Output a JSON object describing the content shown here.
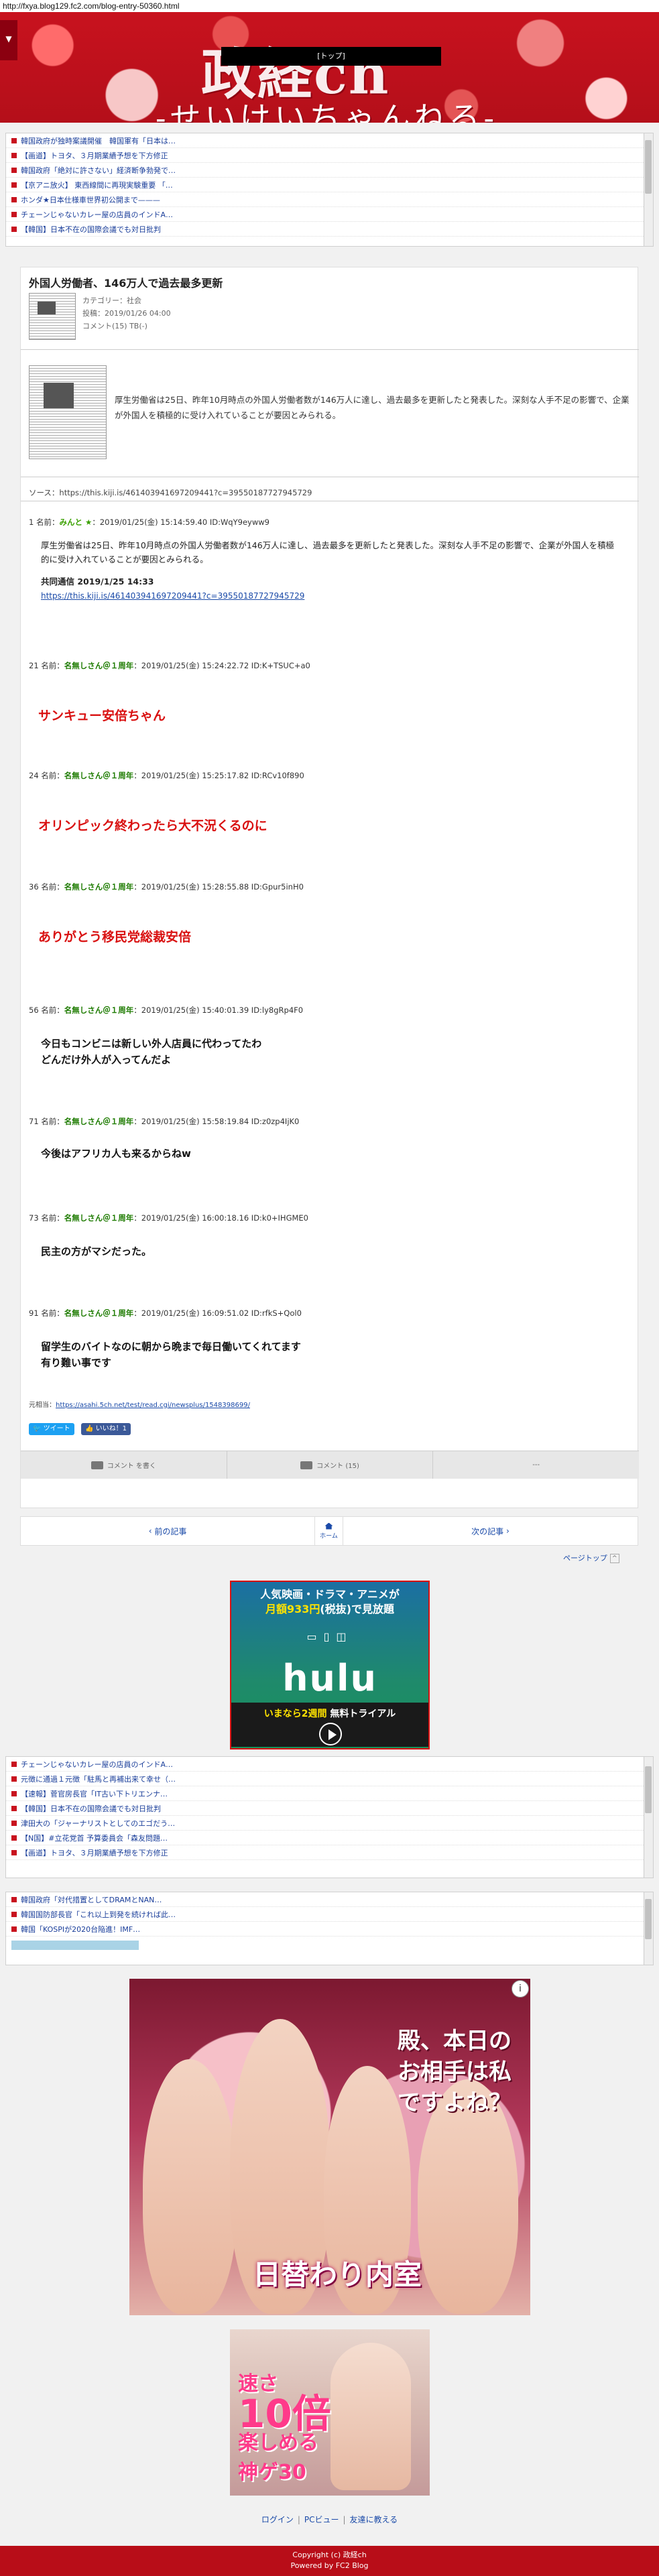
{
  "browser": {
    "url": "http://fxya.blog129.fc2.com/blog-entry-50360.html"
  },
  "header": {
    "menu_icon": "caret-down-icon",
    "nav_label": "[トップ]",
    "title": "政経ch",
    "subtitle": "-せいけいちゃんねる-"
  },
  "top_feed": [
    "韓国政府が独時案議開催　韓国軍有「日本は…",
    "【画道】トヨタ、３月期業績予想を下方修正",
    "韓国政府「絶対に許さない」経済断争勃発で…",
    "【京アニ放火】 東西線間に再現実験重要 「…",
    "ホンダ★日本仕様車世界初公開まで———",
    "チェーンじゃないカレー屋の店員のインドA…",
    "【韓国】日本不在の国際会議でも対日批判"
  ],
  "article": {
    "title": "外国人労働者、146万人で過去最多更新",
    "category": "カテゴリー：社会",
    "posted": "投稿：2019/01/26 04:00",
    "comments": "コメント(15)  TB(-)",
    "lead": "厚生労働省は25日、昨年10月時点の外国人労働者数が146万人に達し、過去最多を更新したと発表した。深刻な人手不足の影響で、企業が外国人を積極的に受け入れていることが要因とみられる。",
    "source": "ソース：https://this.kiji.is/461403941697209441?c=39550187727945729",
    "res1_head_prefix": "1 名前：",
    "res1_name": "みんと ★",
    "res1_meta": "：2019/01/25(金) 15:14:59.40 ID:WqY9eyww9",
    "res1_body": "厚生労働省は25日、昨年10月時点の外国人労働者数が146万人に達し、過去最多を更新したと発表した。深刻な人手不足の影響で、企業が外国人を積極的に受け入れていることが要因とみられる。",
    "res1_credit": "共同通信 2019/1/25 14:33",
    "res1_link": "https://this.kiji.is/461403941697209441?c=39550187727945729",
    "responses": [
      {
        "num": "21 名前：",
        "name": "名無しさん＠１周年",
        "meta": "：2019/01/25(金) 15:24:22.72 ID:K+TSUC+a0",
        "text": "サンキュー安倍ちゃん",
        "style": "red"
      },
      {
        "num": "24 名前：",
        "name": "名無しさん＠１周年",
        "meta": "：2019/01/25(金) 15:25:17.82 ID:RCv10f890",
        "text": "オリンピック終わったら大不況くるのに",
        "style": "red"
      },
      {
        "num": "36 名前：",
        "name": "名無しさん＠１周年",
        "meta": "：2019/01/25(金) 15:28:55.88 ID:Gpur5inH0",
        "text": "ありがとう移民党総裁安倍",
        "style": "red"
      },
      {
        "num": "56 名前：",
        "name": "名無しさん＠１周年",
        "meta": "：2019/01/25(金) 15:40:01.39 ID:ly8gRp4F0",
        "text1": "今日もコンビニは新しい外人店員に代わってたわ",
        "text2": "どんだけ外人が入ってんだよ",
        "style": "black"
      },
      {
        "num": "71 名前：",
        "name": "名無しさん＠１周年",
        "meta": "：2019/01/25(金) 15:58:19.84 ID:z0zp4IjK0",
        "text1": "今後はアフリカ人も来るからねw",
        "style": "black"
      },
      {
        "num": "73 名前：",
        "name": "名無しさん＠１周年",
        "meta": "：2019/01/25(金) 16:00:18.16 ID:k0+IHGME0",
        "text1": "民主の方がマシだった。",
        "style": "black"
      },
      {
        "num": "91 名前：",
        "name": "名無しさん＠１周年",
        "meta": "：2019/01/25(金) 16:09:51.02 ID:rfkS+Qol0",
        "text1": "留学生のバイトなのに朝から晩まで毎日働いてくれてます",
        "text2": "有り難い事です",
        "style": "black"
      }
    ],
    "moto_label": "元相当：",
    "moto_link": "https://asahi.5ch.net/test/read.cgi/newsplus/1548398699/",
    "tweet_label": "ツイート",
    "like_label": "いいね！1",
    "tools": [
      "コメント を書く",
      "コメント (15)",
      "---"
    ]
  },
  "pager": {
    "prev": "前の記事",
    "home": "ホーム",
    "next": "次の記事"
  },
  "pagetop": {
    "label": "ページトップ",
    "icon": "chevron-up-icon"
  },
  "hulu_ad": {
    "line1": "人気映画・ドラマ・アニメが",
    "line2a": "月額933円",
    "line2b": "(税抜)で見放題",
    "logo": "hulu",
    "cta_a": "いまなら2週間",
    "cta_b": " 無料トライアル"
  },
  "mid_feed": [
    "チェーンじゃないカレー屋の店員のインドA…",
    "元徴に通過１元徴「駐馬と再補出来て幸せ（…",
    "【速報】菅官房長官「IT古い下トリエンナ…",
    "【韓国】日本不在の国際会議でも対日批判",
    "津田大の「ジャーナリストとしてのエゴだう…",
    "【N国】#立花党首 予算委員会「森友問題…",
    "【画道】トヨタ、３月期業績予想を下方修正"
  ],
  "low_feed": [
    "韓国政府「対代措置としてDRAMとNAN…",
    "韓国国防部長官「これ以上到発を続ければ此…",
    "韓国「KOSPIが2020台陥進！IMF…"
  ],
  "game_ad": {
    "quote": "殿、本日のお相手は私ですよね？",
    "title": "日替わり内室",
    "info_icon": "info-icon"
  },
  "small_ad": {
    "line1": "速さ",
    "big": "10倍",
    "line2": "楽しめる",
    "line3": "神ゲ30"
  },
  "footer": {
    "links": [
      "ログイン",
      "PCビュー",
      "友達に教える"
    ],
    "copyright": "Copyright (c) 政経ch",
    "powered": "Powered by FC2 Blog"
  }
}
